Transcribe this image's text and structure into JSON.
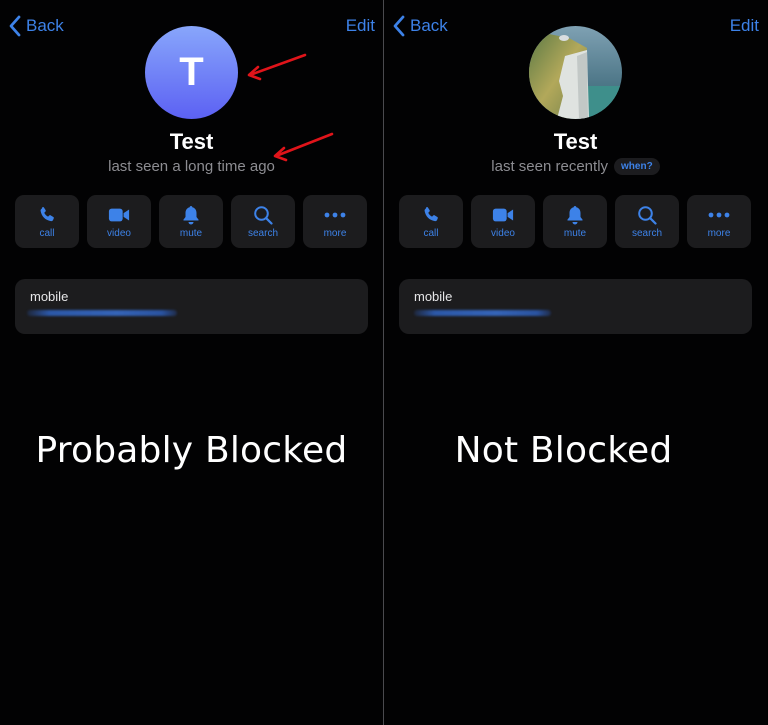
{
  "colors": {
    "accent": "#3d82e8",
    "background": "#000000",
    "card": "#1c1c1e",
    "secondary_text": "#8d8d92",
    "annotation_arrow": "#e0141a",
    "avatar_gradient": [
      "#88a6fb",
      "#5c61f3"
    ]
  },
  "panels": [
    {
      "id": "left",
      "nav": {
        "back_label": "Back",
        "edit_label": "Edit"
      },
      "avatar": {
        "type": "letter",
        "initial": "T"
      },
      "contact_name": "Test",
      "status": "last seen a long time ago",
      "status_badge": null,
      "actions": [
        {
          "icon": "phone-icon",
          "label": "call"
        },
        {
          "icon": "video-camera-icon",
          "label": "video"
        },
        {
          "icon": "bell-icon",
          "label": "mute"
        },
        {
          "icon": "magnifier-icon",
          "label": "search"
        },
        {
          "icon": "ellipsis-icon",
          "label": "more"
        }
      ],
      "info": {
        "label": "mobile",
        "value": "[redacted]"
      },
      "caption": "Probably Blocked",
      "annotations": [
        "arrow pointing to avatar",
        "arrow pointing to last-seen status"
      ]
    },
    {
      "id": "right",
      "nav": {
        "back_label": "Back",
        "edit_label": "Edit"
      },
      "avatar": {
        "type": "photo",
        "description": "white chalk cliff by the sea"
      },
      "contact_name": "Test",
      "status": "last seen recently",
      "status_badge": "when?",
      "actions": [
        {
          "icon": "phone-icon",
          "label": "call"
        },
        {
          "icon": "video-camera-icon",
          "label": "video"
        },
        {
          "icon": "bell-icon",
          "label": "mute"
        },
        {
          "icon": "magnifier-icon",
          "label": "search"
        },
        {
          "icon": "ellipsis-icon",
          "label": "more"
        }
      ],
      "info": {
        "label": "mobile",
        "value": "[redacted]"
      },
      "caption": "Not Blocked"
    }
  ]
}
